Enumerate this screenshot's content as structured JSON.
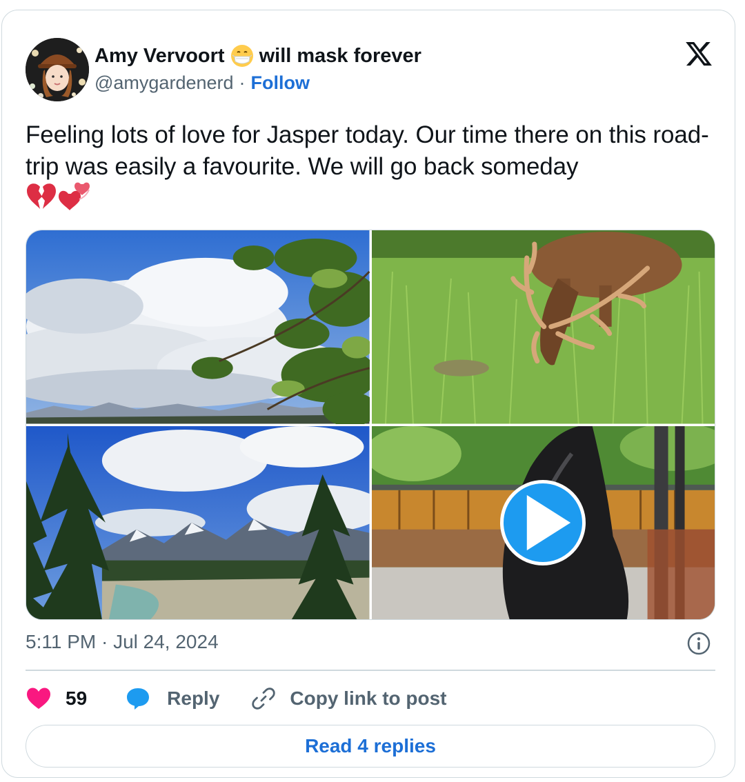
{
  "author": {
    "name": "Amy Vervoort",
    "name_suffix": "will mask forever",
    "handle": "@amygardenerd",
    "separator": "·",
    "follow_label": "Follow"
  },
  "post": {
    "text": "Feeling lots of love for Jasper today. Our time there on this road-trip was easily a favourite. We will go back someday",
    "emojis": [
      "broken-heart-emoji",
      "two-hearts-emoji"
    ],
    "media": [
      {
        "kind": "photo",
        "description": "clouds-and-aspen-leaves"
      },
      {
        "kind": "photo",
        "description": "elk-grazing"
      },
      {
        "kind": "photo",
        "description": "mountain-valley-river"
      },
      {
        "kind": "video",
        "description": "bridge-with-sculpture"
      }
    ],
    "timestamp": "5:11 PM · Jul 24, 2024"
  },
  "actions": {
    "like_count": "59",
    "reply_label": "Reply",
    "copy_label": "Copy link to post",
    "read_replies_label": "Read 4 replies"
  },
  "colors": {
    "accent": "#1d6fd6",
    "like": "#f91880",
    "reply_icon": "#1d9bf0",
    "secondary_text": "#536471",
    "border": "#cfd9de"
  }
}
